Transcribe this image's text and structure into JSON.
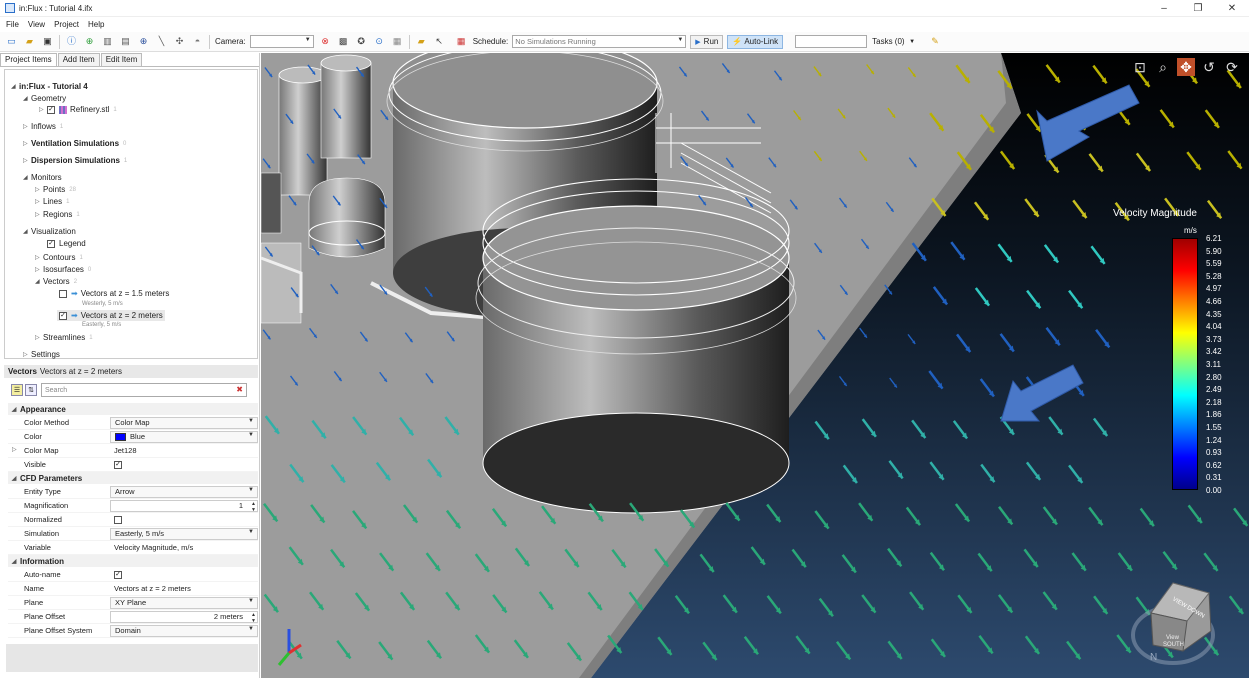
{
  "window": {
    "title": "in:Flux : Tutorial 4.ifx",
    "controls": [
      "–",
      "❐",
      "✕"
    ]
  },
  "menu": [
    "File",
    "View",
    "Project",
    "Help"
  ],
  "toolbar": {
    "camera_label": "Camera:",
    "camera_value": "",
    "schedule_label": "Schedule:",
    "schedule_value": "No Simulations Running",
    "run_label": "Run",
    "autolink_label": "Auto-Link",
    "tasks_label": "Tasks (0)"
  },
  "tabs": [
    "Project Items",
    "Add Item",
    "Edit Item"
  ],
  "tree": {
    "root": "in:Flux - Tutorial 4",
    "geometry": "Geometry",
    "refinery": "Refinery.stl",
    "refinery_count": "1",
    "inflows": "Inflows",
    "inflows_count": "1",
    "ventilation": "Ventilation Simulations",
    "ventilation_count": "0",
    "dispersion": "Dispersion Simulations",
    "dispersion_count": "1",
    "monitors": "Monitors",
    "points": "Points",
    "points_count": "28",
    "lines": "Lines",
    "lines_count": "1",
    "regions": "Regions",
    "regions_count": "1",
    "visualization": "Visualization",
    "legend": "Legend",
    "contours": "Contours",
    "contours_count": "1",
    "isosurfaces": "Isosurfaces",
    "isosurfaces_count": "0",
    "vectors": "Vectors",
    "vectors_count": "2",
    "vec1": "Vectors at z = 1.5 meters",
    "vec1_sub": "Westerly, 5 m/s",
    "vec2": "Vectors at z = 2 meters",
    "vec2_sub": "Easterly, 5 m/s",
    "streamlines": "Streamlines",
    "streamlines_count": "1",
    "settings": "Settings"
  },
  "props": {
    "header_type": "Vectors",
    "header_name": "Vectors at z = 2 meters",
    "search_placeholder": "Search",
    "appearance": "Appearance",
    "color_method_k": "Color Method",
    "color_method_v": "Color Map",
    "color_k": "Color",
    "color_v": "Blue",
    "color_map_k": "Color Map",
    "color_map_v": "Jet128",
    "visible_k": "Visible",
    "cfd": "CFD Parameters",
    "entity_k": "Entity Type",
    "entity_v": "Arrow",
    "mag_k": "Magnification",
    "mag_v": "1",
    "norm_k": "Normalized",
    "sim_k": "Simulation",
    "sim_v": "Easterly, 5 m/s",
    "var_k": "Variable",
    "var_v": "Velocity Magnitude, m/s",
    "information": "Information",
    "autoname_k": "Auto-name",
    "name_k": "Name",
    "name_v": "Vectors at z = 2 meters",
    "plane_k": "Plane",
    "plane_v": "XY Plane",
    "offset_k": "Plane Offset",
    "offset_v": "2 meters",
    "offsys_k": "Plane Offset System",
    "offsys_v": "Domain"
  },
  "legend": {
    "title": "Velocity Magnitude",
    "unit": "m/s",
    "ticks": [
      "6.21",
      "5.90",
      "5.59",
      "5.28",
      "4.97",
      "4.66",
      "4.35",
      "4.04",
      "3.73",
      "3.42",
      "3.11",
      "2.80",
      "2.49",
      "2.18",
      "1.86",
      "1.55",
      "1.24",
      "0.93",
      "0.62",
      "0.31",
      "0.00"
    ]
  },
  "viewcube": {
    "face": "View SOUTH",
    "top": "VIEW DOWN",
    "compass_n": "N"
  },
  "colors": {
    "blue_swatch": "#0000ff",
    "viewport_top": "#000000",
    "viewport_bottom": "#2a4668",
    "floor": "#9a9a9a",
    "annotation_arrow": "#4a78c8"
  }
}
